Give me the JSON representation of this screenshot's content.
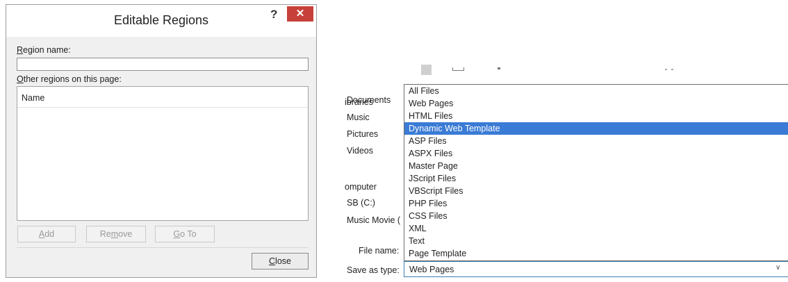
{
  "editable_regions_dialog": {
    "title": "Editable Regions",
    "help_icon": "?",
    "close_icon": "✕",
    "region_name_label": "Region name:",
    "region_name_value": "",
    "other_regions_label": "Other regions on this page:",
    "list_column_header": "Name",
    "buttons": {
      "add": "Add",
      "remove": "Remove",
      "go_to": "Go To",
      "close": "Close"
    }
  },
  "save_as_dialog": {
    "nav_items": [
      "ibraries",
      "Documents",
      "Music",
      "Pictures",
      "Videos",
      "omputer",
      "SB (C:)",
      "Music Movie ("
    ],
    "file_name_label": "File name:",
    "save_as_type_label": "Save as type:",
    "save_as_type_value": "Web Pages",
    "dropdown_icon": "chevron-down-icon",
    "file_type_options": [
      "All Files",
      "Web Pages",
      "HTML Files",
      "Dynamic Web Template",
      "ASP Files",
      "ASPX Files",
      "Master Page",
      "JScript Files",
      "VBScript Files",
      "PHP Files",
      "CSS Files",
      "XML",
      "Text",
      "Page Template"
    ],
    "highlighted_option": "Dynamic Web Template"
  },
  "colors": {
    "close_button_red": "#c7413a",
    "selection_blue": "#3a7bd5",
    "dialog_background": "#f0f0f0"
  }
}
